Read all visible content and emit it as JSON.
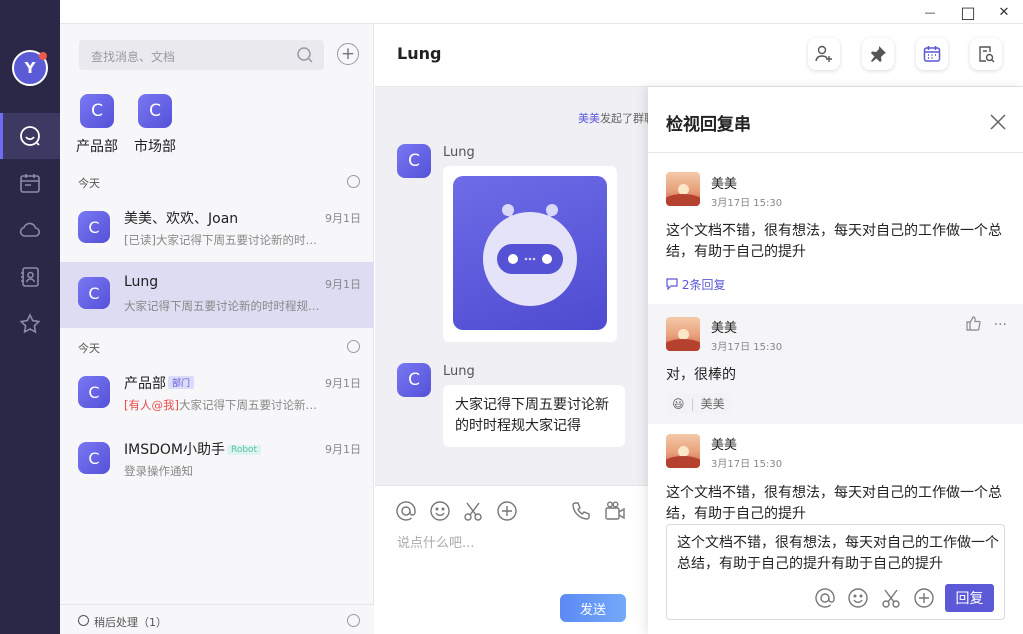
{
  "window": {
    "minimize": "—",
    "maximize": "□",
    "close": "✕"
  },
  "user": {
    "initial": "Y"
  },
  "rail": {
    "items": [
      {
        "icon": "chat-icon",
        "active": true
      },
      {
        "icon": "calendar-icon"
      },
      {
        "icon": "cloud-icon"
      },
      {
        "icon": "contacts-icon"
      },
      {
        "icon": "star-icon"
      }
    ]
  },
  "search": {
    "placeholder": "查找消息、文档"
  },
  "groups": [
    {
      "initial": "C",
      "name": "产品部"
    },
    {
      "initial": "C",
      "name": "市场部"
    }
  ],
  "sections": [
    {
      "label": "今天"
    },
    {
      "label": "今天"
    }
  ],
  "conversations": [
    {
      "initial": "C",
      "name": "美美、欢欢、Joan",
      "time": "9月1日",
      "message": "[已读]大家记得下周五要讨论新的时…"
    },
    {
      "initial": "C",
      "name": "Lung",
      "time": "9月1日",
      "message": "大家记得下周五要讨论新的时时程规…"
    },
    {
      "initial": "C",
      "name": "产品部",
      "tag": "部门",
      "time": "9月1日",
      "mention": "[有人@我]",
      "message": "大家记得下周五要讨论新…"
    },
    {
      "initial": "C",
      "name": "IMSDOM小助手",
      "tag": "Robot",
      "time": "9月1日",
      "message": "登录操作通知"
    }
  ],
  "footer": {
    "label": "稍后处理（1）"
  },
  "chat": {
    "title": "Lung",
    "system_note_name": "美美",
    "system_note_text": "发起了群聊",
    "messages": [
      {
        "initial": "C",
        "sender": "Lung",
        "type": "image"
      },
      {
        "initial": "C",
        "sender": "Lung",
        "text": "大家记得下周五要讨论新的时时程规大家记得"
      }
    ],
    "input_placeholder": "说点什么吧...",
    "send_label": "发送"
  },
  "thread": {
    "title": "检视回复串",
    "replies": [
      {
        "name": "美美",
        "time": "3月17日 15:30",
        "text": "这个文档不错，很有想法，每天对自己的工作做一个总结，有助于自己的提升",
        "count": "2条回复"
      },
      {
        "name": "美美",
        "time": "3月17日 15:30",
        "text": "对，很棒的",
        "reaction_emoji": "😃",
        "reaction_name": "美美",
        "more": "···"
      },
      {
        "name": "美美",
        "time": "3月17日 15:30",
        "text": "这个文档不错，很有想法，每天对自己的工作做一个总结，有助于自己的提升"
      }
    ],
    "input_value": "这个文档不错，很有想法，每天对自己的工作做一个总结，有助于自己的提升有助于自己的提升",
    "reply_label": "回复"
  },
  "colors": {
    "accent": "#5b59d6",
    "rail": "#2a2846",
    "send": "#5b8af5"
  }
}
